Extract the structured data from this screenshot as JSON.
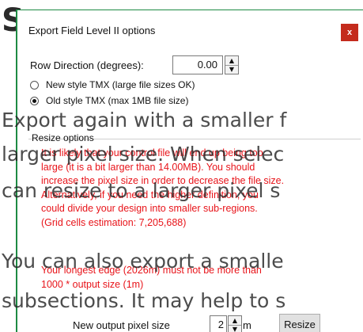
{
  "background": {
    "heading_fragment": "S",
    "lines": [
      "Export again with a smaller f",
      "larger pixel size. When selec",
      "can resize to a larger pixel s",
      "You can also export a smalle",
      "subsections. It may help to s"
    ]
  },
  "dialog": {
    "title": "Export Field Level II options",
    "close_glyph": "x",
    "row_direction": {
      "label": "Row Direction (degrees):",
      "value": "0.00"
    },
    "options": [
      {
        "label": "New style TMX (large file sizes OK)",
        "selected": false
      },
      {
        "label": "Old style TMX (max 1MB file size)",
        "selected": true
      }
    ],
    "resize_group_title": "Resize options",
    "warning_text": "It is likely that your control file will end up being too\nlarge (it is a bit larger than 14.00MB). You should\nincrease the pixel size in order to decrease the file size.\nAlternatively, if you need the higher definition, you\ncould divide your design into smaller sub-regions.\n(Grid cells estimation: 7,205,688)",
    "edge_warning": "Your longest edge (2026m) must not be more than\n1000 * output size (1m)",
    "output": {
      "label": "New output pixel size",
      "value": "2",
      "unit": "m",
      "button": "Resize"
    }
  },
  "colors": {
    "warning": "#e8141a",
    "close_button": "#c42b1c",
    "dialog_accent": "#1e8a44"
  }
}
